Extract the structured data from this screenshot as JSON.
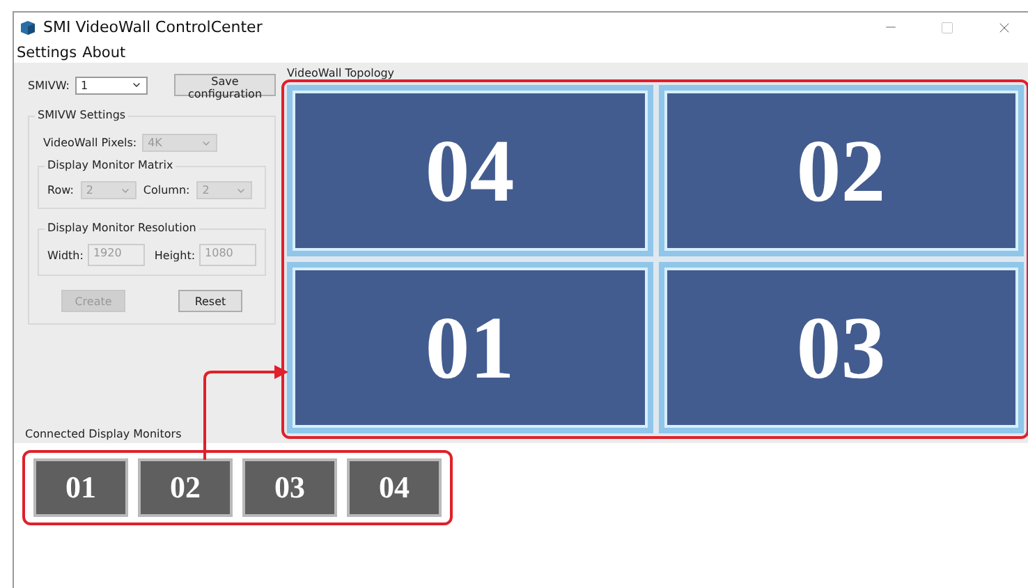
{
  "window": {
    "title": "SMI VideoWall ControlCenter"
  },
  "menu": [
    "Settings",
    "About"
  ],
  "smivw": {
    "label": "SMIVW:",
    "value": "1",
    "disabled": false
  },
  "save_button": {
    "label": "Save configuration",
    "disabled": false
  },
  "settings": {
    "title": "SMIVW Settings",
    "pixels": {
      "label": "VideoWall Pixels:",
      "value": "4K",
      "disabled": true
    },
    "matrix": {
      "title": "Display Monitor Matrix",
      "row_label": "Row:",
      "row_value": "2",
      "column_label": "Column:",
      "column_value": "2",
      "disabled": true
    },
    "resolution": {
      "title": "Display Monitor Resolution",
      "width_label": "Width:",
      "width_value": "1920",
      "height_label": "Height:",
      "height_value": "1080",
      "disabled": true
    },
    "buttons": [
      {
        "label": "Create",
        "disabled": true
      },
      {
        "label": "Reset",
        "disabled": false
      }
    ]
  },
  "topology": {
    "title": "VideoWall Topology",
    "tiles": [
      "04",
      "02",
      "01",
      "03"
    ]
  },
  "connected": {
    "title": "Connected Display Monitors",
    "monitors": [
      "01",
      "02",
      "03",
      "04"
    ]
  }
}
